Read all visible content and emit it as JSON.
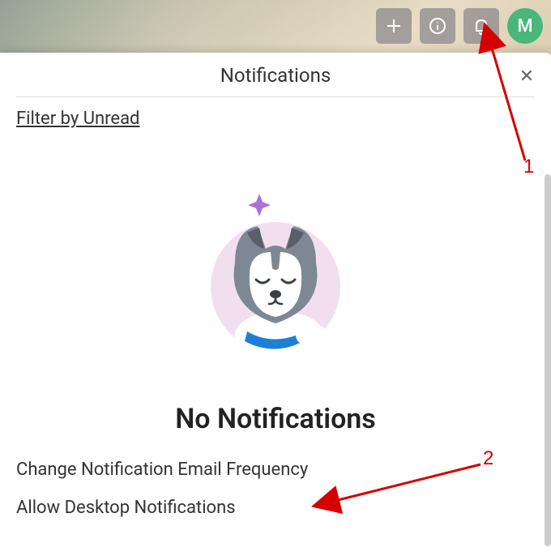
{
  "header": {
    "avatar_initial": "M"
  },
  "panel": {
    "title": "Notifications",
    "filter_link": "Filter by Unread",
    "empty_heading": "No Notifications",
    "settings": {
      "email_frequency": "Change Notification Email Frequency",
      "desktop": "Allow Desktop Notifications"
    }
  },
  "annotations": {
    "label1": "1",
    "label2": "2"
  },
  "colors": {
    "annotation": "#d40000",
    "avatar_bg": "#49b77a"
  }
}
